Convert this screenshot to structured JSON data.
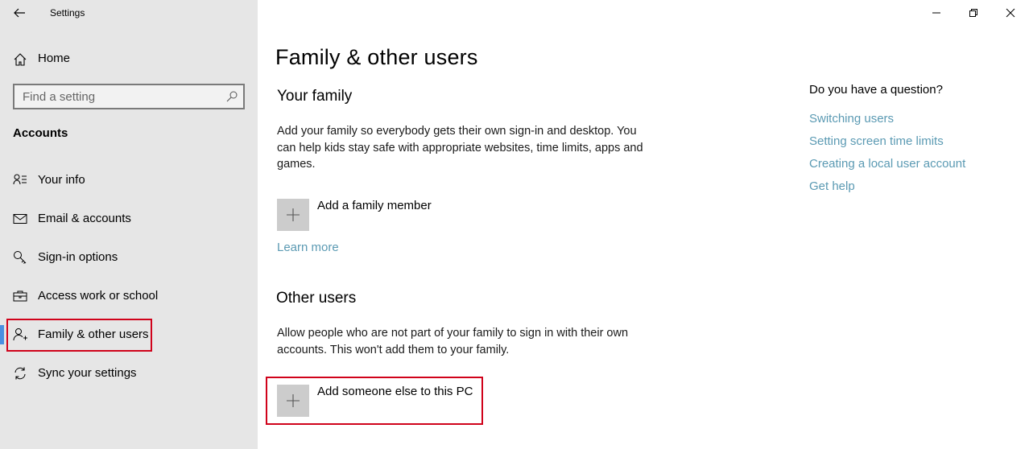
{
  "window": {
    "title": "Settings",
    "controls": {
      "minimize": "minimize-icon",
      "restore": "restore-icon",
      "close": "close-icon"
    }
  },
  "sidebar": {
    "back_icon": "back-arrow-icon",
    "home": {
      "label": "Home",
      "icon": "home-icon"
    },
    "search": {
      "placeholder": "Find a setting",
      "value": "",
      "icon": "search-icon"
    },
    "section_title": "Accounts",
    "items": [
      {
        "label": "Your info",
        "icon": "contact-info-icon",
        "selected": false
      },
      {
        "label": "Email & accounts",
        "icon": "mail-icon",
        "selected": false
      },
      {
        "label": "Sign-in options",
        "icon": "key-icon",
        "selected": false
      },
      {
        "label": "Access work or school",
        "icon": "briefcase-icon",
        "selected": false
      },
      {
        "label": "Family & other users",
        "icon": "add-person-icon",
        "selected": true
      },
      {
        "label": "Sync your settings",
        "icon": "sync-icon",
        "selected": false
      }
    ]
  },
  "main": {
    "page_title": "Family & other users",
    "your_family": {
      "heading": "Your family",
      "description": "Add your family so everybody gets their own sign-in and desktop. You can help kids stay safe with appropriate websites, time limits, apps and games.",
      "add_label": "Add a family member",
      "learn_more": "Learn more"
    },
    "other_users": {
      "heading": "Other users",
      "description": "Allow people who are not part of your family to sign in with their own accounts. This won't add them to your family.",
      "add_label": "Add someone else to this PC"
    },
    "help": {
      "title": "Do you have a question?",
      "links": [
        "Switching users",
        "Setting screen time limits",
        "Creating a local user account",
        "Get help"
      ]
    }
  },
  "colors": {
    "sidebar_bg": "#e6e6e6",
    "accent": "#4a90e2",
    "link": "#5b9ab3",
    "highlight": "#d0021b",
    "plus_tile": "#cccccc"
  }
}
